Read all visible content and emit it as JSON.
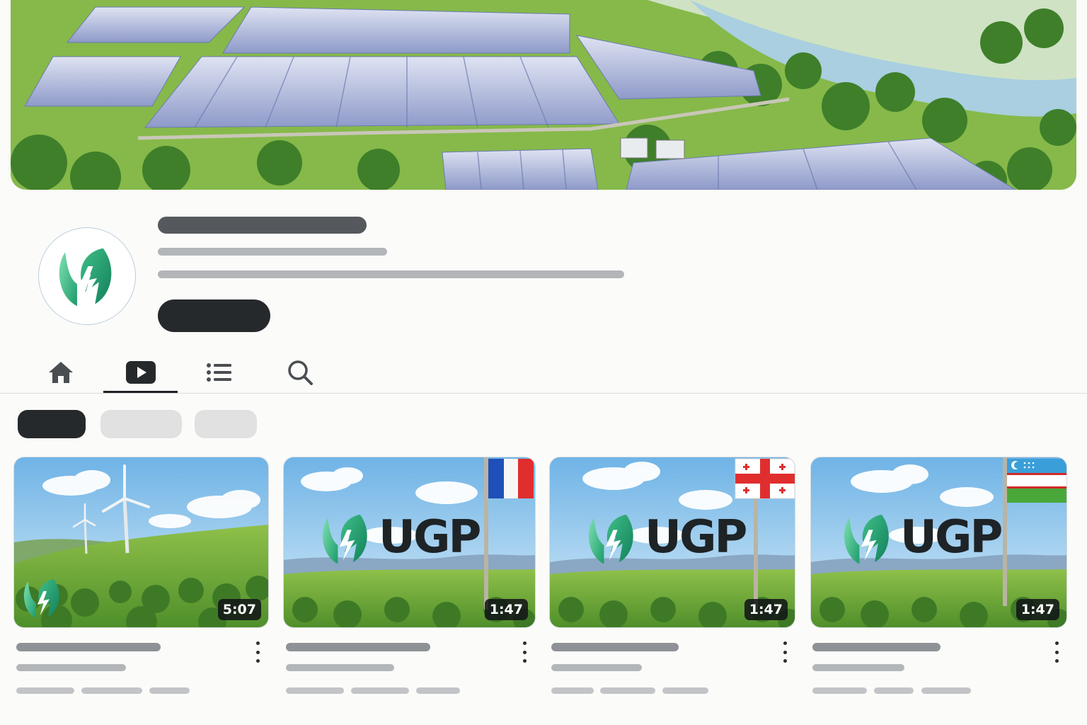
{
  "channel": {
    "banner_icon": "solar-farm-landscape-illustration",
    "avatar_icon": "ugp-leaf-bolt-logo-icon",
    "brand_colors": {
      "green_light": "#5fd39a",
      "green_dark": "#1f9a6a",
      "text_dark": "#1e2326"
    }
  },
  "tabs": [
    {
      "icon": "home-icon",
      "selected": false
    },
    {
      "icon": "videos-play-icon",
      "selected": true
    },
    {
      "icon": "playlists-icon",
      "selected": false
    },
    {
      "icon": "search-icon",
      "selected": false
    }
  ],
  "filter_chips": [
    {
      "selected": true
    },
    {
      "selected": false
    },
    {
      "selected": false
    }
  ],
  "videos": [
    {
      "duration": "5:07",
      "thumbnail": "wind-turbines-hills",
      "logo_text": "",
      "flag": ""
    },
    {
      "duration": "1:47",
      "thumbnail": "ugp-logo-meadow",
      "logo_text": "UGP",
      "flag": "france-flag"
    },
    {
      "duration": "1:47",
      "thumbnail": "ugp-logo-meadow",
      "logo_text": "UGP",
      "flag": "georgia-flag"
    },
    {
      "duration": "1:47",
      "thumbnail": "ugp-logo-meadow",
      "logo_text": "UGP",
      "flag": "uzbekistan-flag"
    }
  ]
}
